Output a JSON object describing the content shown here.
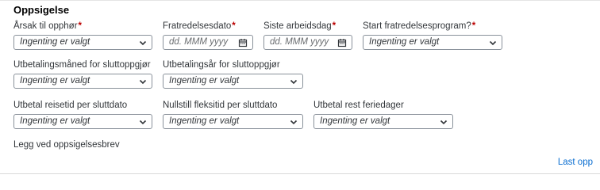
{
  "section": {
    "title": "Oppsigelse"
  },
  "fields": {
    "arsak": {
      "label": "Årsak til opphør",
      "required": "*",
      "value": "Ingenting er valgt"
    },
    "fratredelsesdato": {
      "label": "Fratredelsesdato",
      "required": "*",
      "placeholder": "dd. MMM yyyy"
    },
    "siste_arbeidsdag": {
      "label": "Siste arbeidsdag",
      "required": "*",
      "placeholder": "dd. MMM yyyy"
    },
    "start_program": {
      "label": "Start fratredelsesprogram?",
      "required": "*",
      "value": "Ingenting er valgt"
    },
    "utbetalingsmaned": {
      "label": "Utbetalingsmåned for sluttoppgjør",
      "value": "Ingenting er valgt"
    },
    "utbetalingsar": {
      "label": "Utbetalingsår for sluttoppgjør",
      "value": "Ingenting er valgt"
    },
    "reisetid": {
      "label": "Utbetal reisetid per sluttdato",
      "value": "Ingenting er valgt"
    },
    "fleksitid": {
      "label": "Nullstill fleksitid per sluttdato",
      "value": "Ingenting er valgt"
    },
    "feriedager": {
      "label": "Utbetal rest feriedager",
      "value": "Ingenting er valgt"
    }
  },
  "attachment": {
    "label": "Legg ved oppsigelsesbrev"
  },
  "actions": {
    "upload_label": "Last opp"
  },
  "icons": {
    "dropdown": "chevron-down-icon",
    "date": "calendar-icon"
  },
  "colors": {
    "required": "#bb0000",
    "link": "#0a6ed1",
    "border": "#89919a"
  }
}
